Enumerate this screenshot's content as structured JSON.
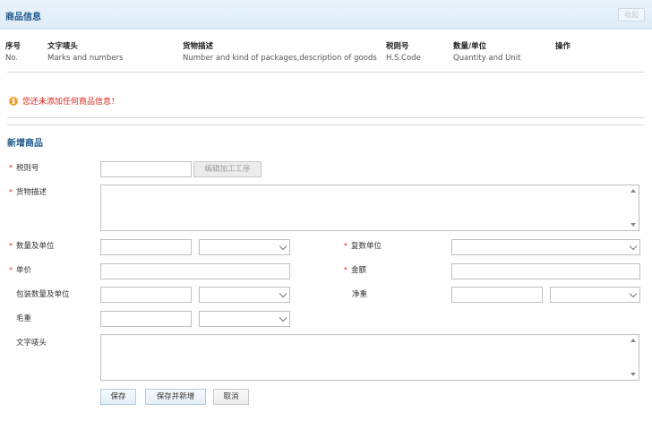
{
  "header": {
    "title": "商品信息",
    "collapse_label": "收起"
  },
  "table": {
    "columns": [
      {
        "zh": "序号",
        "en": "No."
      },
      {
        "zh": "文字唛头",
        "en": "Marks and numbers"
      },
      {
        "zh": "货物描述",
        "en": "Number and kind of packages,description of goods"
      },
      {
        "zh": "税则号",
        "en": "H.S.Code"
      },
      {
        "zh": "数量/单位",
        "en": "Quantity and Unit"
      },
      {
        "zh": "操作",
        "en": ""
      }
    ]
  },
  "warning": {
    "text": "您还未添加任何商品信息！"
  },
  "form": {
    "section_title": "新增商品",
    "labels": {
      "hs_code": "税则号",
      "goods_desc": "货物描述",
      "quantity_unit": "数量及单位",
      "compound_unit": "复数单位",
      "unit_price": "单价",
      "amount": "金额",
      "package_qty_unit": "包装数量及单位",
      "net_weight": "净重",
      "gross_weight": "毛重",
      "marks": "文字唛头"
    },
    "edit_process_label": "编辑加工工序",
    "buttons": {
      "save": "保存",
      "save_new": "保存并新增",
      "cancel": "取消"
    }
  }
}
